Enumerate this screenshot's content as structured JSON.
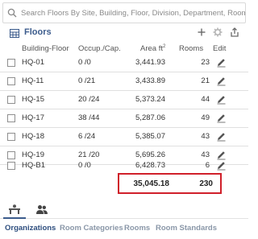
{
  "search": {
    "placeholder": "Search Floors By Site, Building, Floor, Division, Department, Room, Edit"
  },
  "panel": {
    "title": "Floors"
  },
  "columns": {
    "floor": "Building-Floor",
    "occ": "Occup./Cap.",
    "area": "Area ft",
    "area_sup": "2",
    "rooms": "Rooms",
    "edit": "Edit"
  },
  "rows": [
    {
      "floor": "HQ-01",
      "occ": "0 /0",
      "area": "3,441.93",
      "rooms": "23"
    },
    {
      "floor": "HQ-11",
      "occ": "0 /21",
      "area": "3,433.89",
      "rooms": "21"
    },
    {
      "floor": "HQ-15",
      "occ": "20 /24",
      "area": "5,373.24",
      "rooms": "44"
    },
    {
      "floor": "HQ-17",
      "occ": "38 /44",
      "area": "5,287.06",
      "rooms": "49"
    },
    {
      "floor": "HQ-18",
      "occ": "6 /24",
      "area": "5,385.07",
      "rooms": "43"
    },
    {
      "floor": "HQ-19",
      "occ": "21 /20",
      "area": "5,695.26",
      "rooms": "43"
    },
    {
      "floor": "HQ-B1",
      "occ": "0 /0",
      "area": "6,428.73",
      "rooms": "6"
    }
  ],
  "totals": {
    "area": "35,045.18",
    "rooms": "230"
  },
  "bottom_nav": [
    "Organizations",
    "Room Categories",
    "Rooms",
    "Room Standards"
  ],
  "colors": {
    "accent": "#3b5b8c",
    "highlight_border": "#d0202a"
  },
  "icons": {
    "search": "search-icon",
    "floors": "floor-plan-icon",
    "add": "plus-icon",
    "settings": "gear-icon",
    "export": "export-icon",
    "edit": "pencil-icon",
    "tab1": "desk-icon",
    "tab2": "people-icon"
  }
}
